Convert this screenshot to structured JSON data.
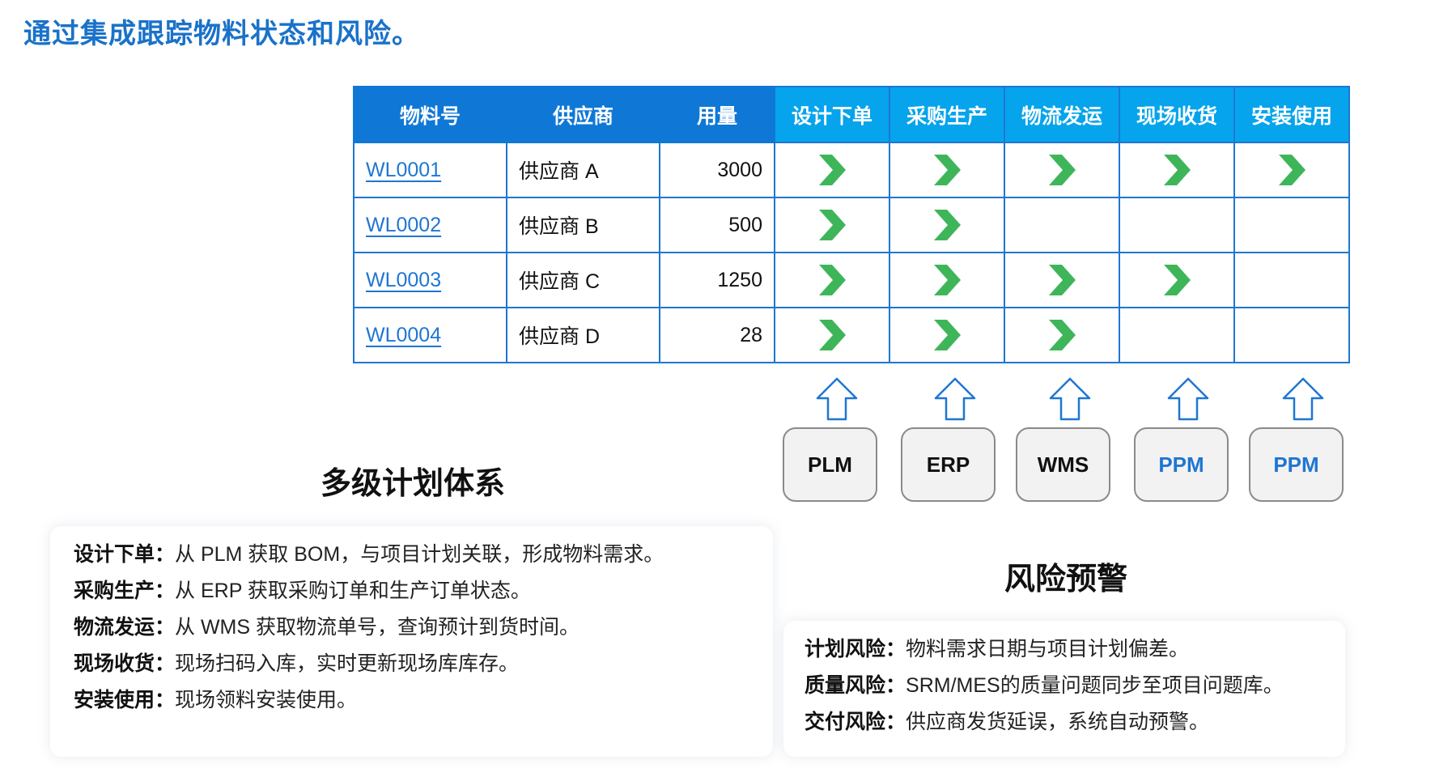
{
  "title": "通过集成跟踪物料状态和风险。",
  "colors": {
    "title": "#1a72c9",
    "header_base": "#0f78d6",
    "header_stage": "#06a4ec",
    "border": "#1f76d2",
    "chevron": "#3fb55a",
    "link": "#1f76d2",
    "sys_blue_text": "#1f76d2"
  },
  "table": {
    "headers": [
      "物料号",
      "供应商",
      "用量",
      "设计下单",
      "采购生产",
      "物流发运",
      "现场收货",
      "安装使用"
    ],
    "rows": [
      {
        "id": "WL0001",
        "supplier": "供应商 A",
        "qty": "3000",
        "stages": [
          true,
          true,
          true,
          true,
          true
        ]
      },
      {
        "id": "WL0002",
        "supplier": "供应商 B",
        "qty": "500",
        "stages": [
          true,
          true,
          false,
          false,
          false
        ]
      },
      {
        "id": "WL0003",
        "supplier": "供应商 C",
        "qty": "1250",
        "stages": [
          true,
          true,
          true,
          true,
          false
        ]
      },
      {
        "id": "WL0004",
        "supplier": "供应商 D",
        "qty": "28",
        "stages": [
          true,
          true,
          true,
          false,
          false
        ]
      }
    ]
  },
  "systems": [
    {
      "label": "PLM",
      "color": "#111111"
    },
    {
      "label": "ERP",
      "color": "#111111"
    },
    {
      "label": "WMS",
      "color": "#111111"
    },
    {
      "label": "PPM",
      "color": "#1f76d2"
    },
    {
      "label": "PPM",
      "color": "#1f76d2"
    }
  ],
  "planning": {
    "heading": "多级计划体系",
    "items": [
      {
        "label": "设计下单：",
        "text": "从 PLM 获取 BOM，与项目计划关联，形成物料需求。"
      },
      {
        "label": "采购生产：",
        "text": "从 ERP 获取采购订单和生产订单状态。"
      },
      {
        "label": "物流发运：",
        "text": "从 WMS 获取物流单号，查询预计到货时间。"
      },
      {
        "label": "现场收货：",
        "text": "现场扫码入库，实时更新现场库库存。"
      },
      {
        "label": "安装使用：",
        "text": "现场领料安装使用。"
      }
    ]
  },
  "risk": {
    "heading": "风险预警",
    "items": [
      {
        "label": "计划风险：",
        "text": "物料需求日期与项目计划偏差。"
      },
      {
        "label": "质量风险：",
        "text": "SRM/MES的质量问题同步至项目问题库。"
      },
      {
        "label": "交付风险：",
        "text": "供应商发货延误，系统自动预警。"
      }
    ]
  }
}
